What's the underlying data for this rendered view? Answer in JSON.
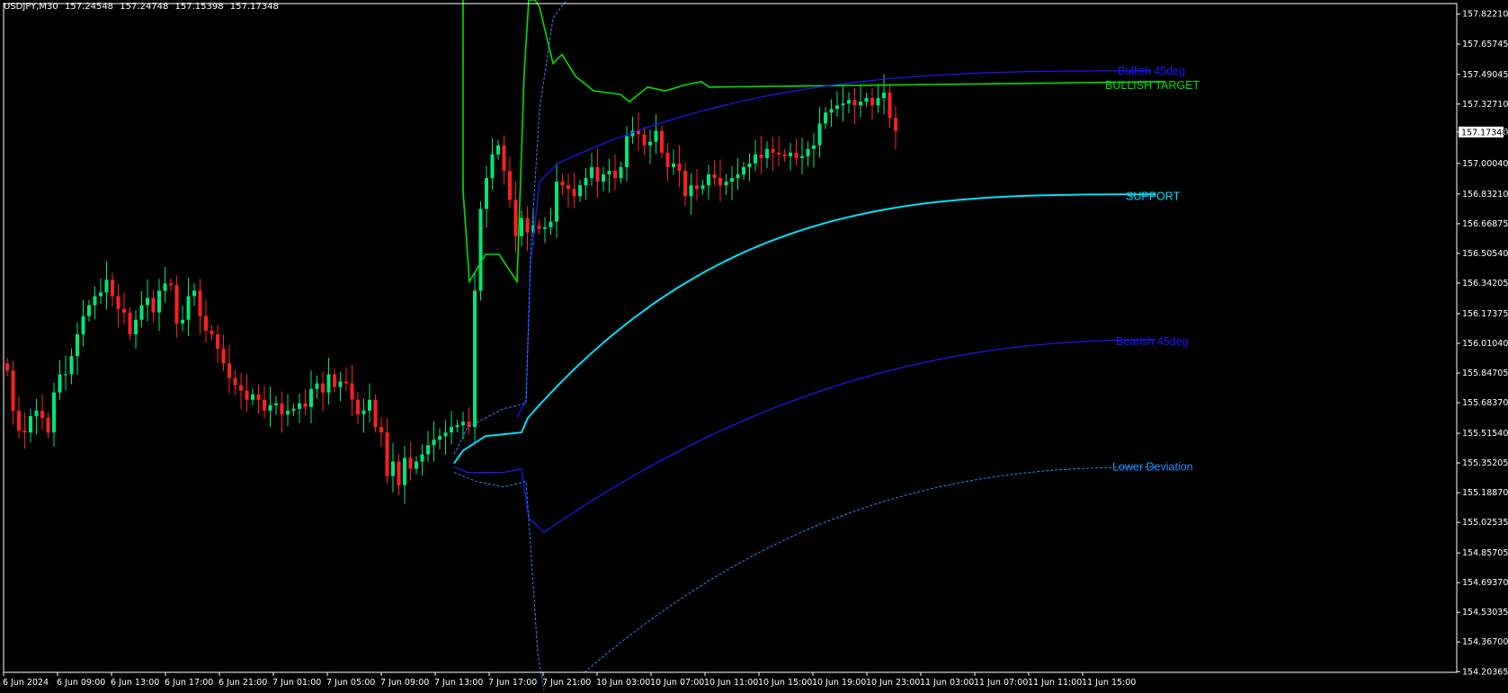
{
  "header": {
    "symbol": "USDJPY,M30",
    "open": "157.24548",
    "high": "157.24748",
    "low": "157.15398",
    "close": "157.17348"
  },
  "colors": {
    "background": "#000000",
    "frame": "#ffffff",
    "bull_candle": "#00e676",
    "bear_candle": "#ff2020",
    "bullish_target": "#00e000",
    "support": "#00e0ff",
    "deg45": "#1a1aff",
    "deviation": "#1e90ff"
  },
  "chart_data": {
    "type": "candlestick",
    "symbol": "USDJPY",
    "timeframe": "M30",
    "ylim": [
      154.2,
      157.88
    ],
    "y_ticks": [
      "157.82210",
      "157.65745",
      "157.49045",
      "157.32710",
      "157.17348",
      "157.00040",
      "156.83210",
      "156.66875",
      "156.50540",
      "156.34205",
      "156.17375",
      "156.01040",
      "155.84705",
      "155.68370",
      "155.51540",
      "155.35205",
      "155.18870",
      "155.02535",
      "154.85705",
      "154.69370",
      "154.53035",
      "154.36700",
      "154.20365"
    ],
    "current_price": "157.17348",
    "x_ticks": [
      "6 Jun 2024",
      "6 Jun 09:00",
      "6 Jun 13:00",
      "6 Jun 17:00",
      "6 Jun 21:00",
      "7 Jun 01:00",
      "7 Jun 05:00",
      "7 Jun 09:00",
      "7 Jun 13:00",
      "7 Jun 17:00",
      "7 Jun 21:00",
      "10 Jun 03:00",
      "10 Jun 07:00",
      "10 Jun 11:00",
      "10 Jun 15:00",
      "10 Jun 19:00",
      "10 Jun 23:00",
      "11 Jun 03:00",
      "11 Jun 07:00",
      "11 Jun 11:00",
      "11 Jun 15:00"
    ],
    "candle_closes": [
      155.86,
      155.64,
      155.53,
      155.52,
      155.61,
      155.64,
      155.6,
      155.52,
      155.74,
      155.84,
      155.84,
      155.94,
      156.06,
      156.16,
      156.22,
      156.27,
      156.29,
      156.36,
      156.27,
      156.2,
      156.18,
      156.06,
      156.14,
      156.22,
      156.26,
      156.18,
      156.3,
      156.34,
      156.33,
      156.12,
      156.14,
      156.27,
      156.3,
      156.16,
      156.08,
      156.06,
      155.98,
      155.9,
      155.82,
      155.78,
      155.75,
      155.7,
      155.73,
      155.7,
      155.64,
      155.67,
      155.68,
      155.62,
      155.64,
      155.65,
      155.68,
      155.66,
      155.76,
      155.79,
      155.74,
      155.84,
      155.77,
      155.8,
      155.79,
      155.7,
      155.62,
      155.64,
      155.7,
      155.55,
      155.52,
      155.28,
      155.36,
      155.23,
      155.38,
      155.32,
      155.36,
      155.4,
      155.45,
      155.48,
      155.5,
      155.52,
      155.55,
      155.56,
      155.58,
      155.55,
      156.3,
      156.75,
      156.92,
      157.05,
      157.1,
      156.96,
      156.8,
      156.6,
      156.7,
      156.62,
      156.66,
      156.64,
      156.65,
      156.68,
      156.9,
      156.88,
      156.86,
      156.82,
      156.88,
      156.92,
      156.98,
      156.9,
      156.94,
      156.96,
      156.92,
      156.98,
      157.15,
      157.18,
      157.16,
      157.1,
      157.12,
      157.18,
      157.06,
      156.98,
      157.0,
      156.96,
      156.82,
      156.88,
      156.86,
      156.88,
      156.94,
      156.92,
      156.88,
      156.9,
      156.92,
      156.94,
      156.98,
      157.0,
      157.05,
      157.03,
      157.08,
      157.06,
      157.05,
      157.04,
      157.06,
      157.03,
      157.04,
      157.08,
      157.1,
      157.22,
      157.28,
      157.3,
      157.32,
      157.33,
      157.35,
      157.32,
      157.34,
      157.36,
      157.32,
      157.36,
      157.39,
      157.25,
      157.18
    ],
    "series": [
      {
        "name": "BULLISH TARGET",
        "end_value": 157.44
      },
      {
        "name": "Bullish 45deg",
        "end_value": 157.51
      },
      {
        "name": "SUPPORT",
        "end_value": 156.83
      },
      {
        "name": "Bearish 45deg",
        "end_value": 156.03
      },
      {
        "name": "Lower Deviation",
        "end_value": 155.33
      }
    ]
  },
  "labels": {
    "bullish_45": "Bullish 45deg",
    "bullish_target": "BULLISH TARGET",
    "support": "SUPPORT",
    "bearish_45": "Bearish 45deg",
    "lower_deviation": "Lower Deviation"
  }
}
